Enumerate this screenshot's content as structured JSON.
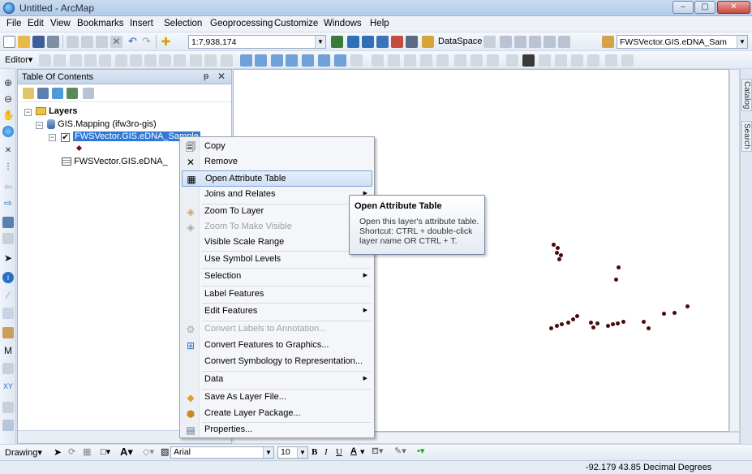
{
  "window": {
    "title": "Untitled - ArcMap",
    "min": "–",
    "max": "▢",
    "close": "✕"
  },
  "menu": [
    "File",
    "Edit",
    "View",
    "Bookmarks",
    "Insert",
    "Selection",
    "Geoprocessing",
    "Customize",
    "Windows",
    "Help"
  ],
  "toolbar1": {
    "scale": "1:7,938,174",
    "dataspace": "DataSpace",
    "layer_combo": "FWSVector.GIS.eDNA_Sam"
  },
  "toolbar2": {
    "editor": "Editor▾"
  },
  "toc": {
    "title": "Table Of Contents",
    "pin": "ᵽ",
    "close": "✕",
    "layers_label": "Layers",
    "db_label": "GIS.Mapping (ifw3ro-gis)",
    "layer_label": "FWSVector.GIS.eDNA_Sample",
    "table_label": "FWSVector.GIS.eDNA_"
  },
  "context_menu": {
    "copy": "Copy",
    "remove": "Remove",
    "open_attribute_table": "Open Attribute Table",
    "joins_relates": "Joins and Relates",
    "zoom_to_layer": "Zoom To Layer",
    "zoom_to_make_visible": "Zoom To Make Visible",
    "visible_scale_range": "Visible Scale Range",
    "use_symbol_levels": "Use Symbol Levels",
    "selection": "Selection",
    "label_features": "Label Features",
    "edit_features": "Edit Features",
    "convert_labels": "Convert Labels to Annotation...",
    "convert_features": "Convert Features to Graphics...",
    "convert_symbology": "Convert Symbology to Representation...",
    "data": "Data",
    "save_layer_file": "Save As Layer File...",
    "create_layer_package": "Create Layer Package...",
    "properties": "Properties..."
  },
  "tooltip": {
    "title": "Open Attribute Table",
    "body": "Open this layer's attribute table. Shortcut: CTRL + double-click layer name OR CTRL + T."
  },
  "dock_tabs": {
    "catalog": "Catalog",
    "search": "Search"
  },
  "drawing": {
    "label": "Drawing▾",
    "font": "Arial",
    "size": "10",
    "bold": "B",
    "italic": "I",
    "underline": "U",
    "font_color": "A"
  },
  "status": {
    "coords": "-92.179  43.85 Decimal Degrees"
  },
  "colors": {
    "selection": "#3179d6",
    "points": "#4a0a0a"
  }
}
